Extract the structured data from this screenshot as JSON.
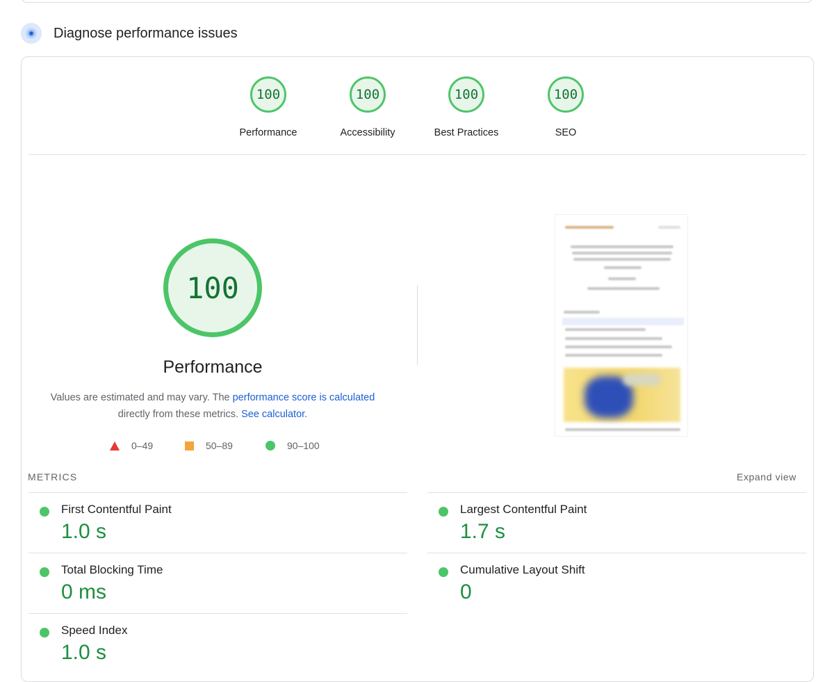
{
  "section": {
    "title": "Diagnose performance issues",
    "icon": "gauge-icon"
  },
  "scores": [
    {
      "value": "100",
      "label": "Performance"
    },
    {
      "value": "100",
      "label": "Accessibility"
    },
    {
      "value": "100",
      "label": "Best Practices"
    },
    {
      "value": "100",
      "label": "SEO"
    }
  ],
  "main_score": {
    "value": "100",
    "title": "Performance",
    "note_prefix": "Values are estimated and may vary. The ",
    "note_link1": "performance score is calculated",
    "note_middle": "directly from these metrics.",
    "note_link2": "See calculator."
  },
  "legend": [
    {
      "shape": "triangle",
      "label": "0–49",
      "color": "#e53935"
    },
    {
      "shape": "square",
      "label": "50–89",
      "color": "#f5a43a"
    },
    {
      "shape": "circle",
      "label": "90–100",
      "color": "#4cc568"
    }
  ],
  "metrics": {
    "header": "METRICS",
    "expand_label": "Expand view",
    "items": [
      {
        "name": "First Contentful Paint",
        "value": "1.0 s"
      },
      {
        "name": "Largest Contentful Paint",
        "value": "1.7 s"
      },
      {
        "name": "Total Blocking Time",
        "value": "0 ms"
      },
      {
        "name": "Cumulative Layout Shift",
        "value": "0"
      },
      {
        "name": "Speed Index",
        "value": "1.0 s"
      }
    ]
  },
  "colors": {
    "pass": "#4cc568",
    "pass_text": "#1e8e3e",
    "link": "#1a5fd6"
  }
}
